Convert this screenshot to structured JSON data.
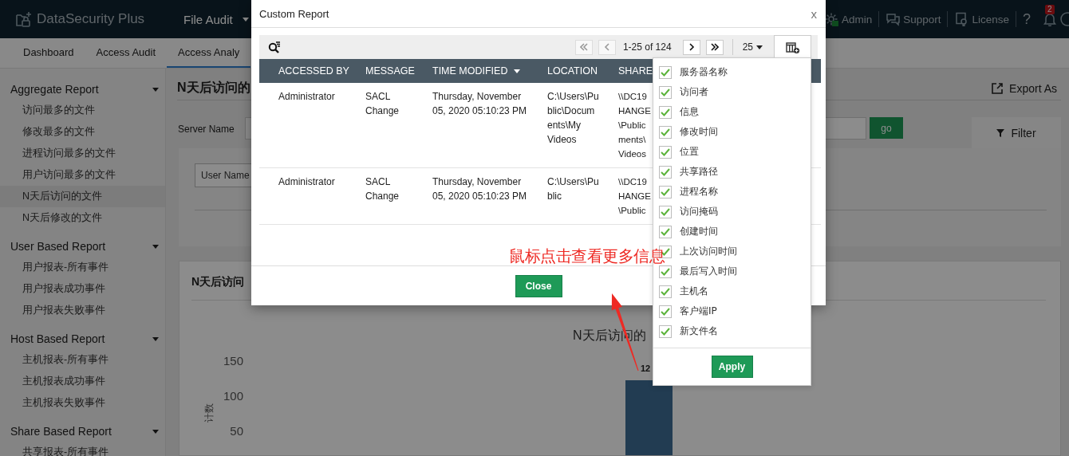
{
  "top_bar": {
    "product": "DataSecurity Plus",
    "module_menu": "File Audit",
    "links": [
      {
        "kind": "admin",
        "label": "Admin"
      },
      {
        "kind": "support",
        "label": "Support"
      },
      {
        "kind": "license",
        "label": "License"
      }
    ],
    "help": "?",
    "notifications_badge": "2"
  },
  "nav_tabs": [
    {
      "label": "Dashboard",
      "selected": false
    },
    {
      "label": "Access Audit",
      "selected": false
    },
    {
      "label": "Access Analy",
      "selected": true
    }
  ],
  "sidebar": {
    "groups": [
      {
        "title": "Aggregate Report",
        "expanded": true,
        "items": [
          {
            "label": "访问最多的文件",
            "selected": false
          },
          {
            "label": "修改最多的文件",
            "selected": false
          },
          {
            "label": "进程访问最多的文件",
            "selected": false
          },
          {
            "label": "用户访问最多的文件",
            "selected": false
          },
          {
            "label": "N天后访问的文件",
            "selected": true
          },
          {
            "label": "N天后修改的文件",
            "selected": false
          }
        ]
      },
      {
        "title": "User Based Report",
        "expanded": true,
        "items": [
          {
            "label": "用户报表-所有事件",
            "selected": false
          },
          {
            "label": "用户报表成功事件",
            "selected": false
          },
          {
            "label": "用户报表失败事件",
            "selected": false
          }
        ]
      },
      {
        "title": "Host Based Report",
        "expanded": true,
        "items": [
          {
            "label": "主机报表-所有事件",
            "selected": false
          },
          {
            "label": "主机报表成功事件",
            "selected": false
          },
          {
            "label": "主机报表失败事件",
            "selected": false
          }
        ]
      },
      {
        "title": "Share Based Report",
        "expanded": true,
        "items": [
          {
            "label": "共享报表-所有事件",
            "selected": false
          }
        ]
      }
    ]
  },
  "report": {
    "title": "N天后访问的",
    "export": "Export As",
    "server_label": "Server Name",
    "go": "go",
    "filter": "Filter",
    "user_field": {
      "placeholder": "User Name"
    },
    "chart_card": {
      "title": "N天后访问",
      "chart": {
        "title": "N天后访问的",
        "y_axis_title": "计数",
        "y_ticks": [
          "150",
          "100",
          "50"
        ],
        "bar_label": "12"
      }
    }
  },
  "modal": {
    "title": "Custom Report",
    "close": "x",
    "pager": {
      "range": "1-25 of 124",
      "page_size": "25"
    },
    "columns": [
      {
        "label": "ACCESSED BY"
      },
      {
        "label": "MESSAGE"
      },
      {
        "label": "TIME MODIFIED",
        "sorted": true
      },
      {
        "label": "LOCATION"
      },
      {
        "label": "SHARE"
      }
    ],
    "rows": [
      [
        "Administrator",
        "SACL Change",
        "Thursday, November 05, 2020 05:10:23 PM",
        "C:\\Users\\Pu\nblic\\Docum\nents\\My\nVideos",
        "\\\\DC19\nHANGE\n\\Public\nments\\\nVideos"
      ],
      [
        "Administrator",
        "SACL Change",
        "Thursday, November 05, 2020 05:10:23 PM",
        "C:\\Users\\Pu\nblic",
        "\\\\DC19\nHANGE\n\\Public"
      ]
    ],
    "close_button": "Close"
  },
  "column_picker": {
    "options": [
      {
        "label": "服务器名称",
        "checked": true
      },
      {
        "label": "访问者",
        "checked": true
      },
      {
        "label": "信息",
        "checked": true
      },
      {
        "label": "修改时间",
        "checked": true
      },
      {
        "label": "位置",
        "checked": true
      },
      {
        "label": "共享路径",
        "checked": true
      },
      {
        "label": "进程名称",
        "checked": true
      },
      {
        "label": "访问掩码",
        "checked": true
      },
      {
        "label": "创建时间",
        "checked": true
      },
      {
        "label": "上次访问时间",
        "checked": true
      },
      {
        "label": "最后写入时间",
        "checked": true
      },
      {
        "label": "主机名",
        "checked": true
      },
      {
        "label": "客户端IP",
        "checked": true
      },
      {
        "label": "新文件名",
        "checked": true
      }
    ],
    "apply": "Apply"
  },
  "annotation": {
    "text": "鼠标点击查看更多信息"
  }
}
